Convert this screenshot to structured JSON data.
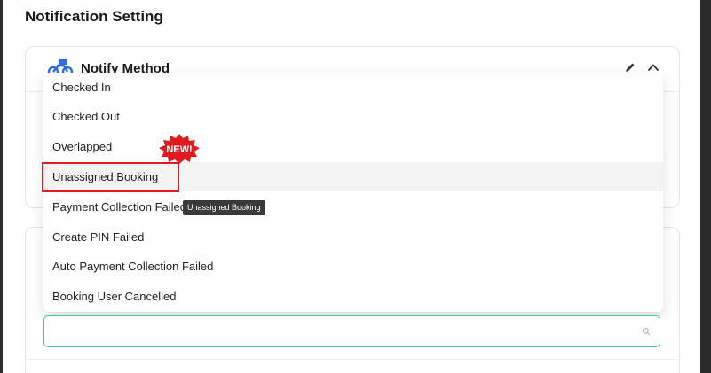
{
  "page": {
    "title": "Notification Setting"
  },
  "notify_method_card": {
    "title": "Notify Method",
    "icon": "delivery-bike-icon",
    "actions": [
      {
        "icon": "edit-pencil-icon"
      },
      {
        "icon": "chevron-up-icon"
      }
    ]
  },
  "dropdown": {
    "options": [
      {
        "label": "Checked In"
      },
      {
        "label": "Checked Out"
      },
      {
        "label": "Overlapped"
      },
      {
        "label": "Unassigned Booking"
      },
      {
        "label": "Payment Collection Failed"
      },
      {
        "label": "Create PIN Failed"
      },
      {
        "label": "Auto Payment Collection Failed"
      },
      {
        "label": "Booking User Cancelled"
      }
    ],
    "active_label": "Unassigned Booking"
  },
  "badge": {
    "text": "NEW!",
    "color": "#e01b1b"
  },
  "tooltip": {
    "text": "Unassigned Booking"
  },
  "search": {
    "value": "",
    "placeholder": "",
    "icon": "search-icon"
  },
  "colors": {
    "focus_border": "#3fc1b4",
    "highlight": "#e31d1d"
  }
}
